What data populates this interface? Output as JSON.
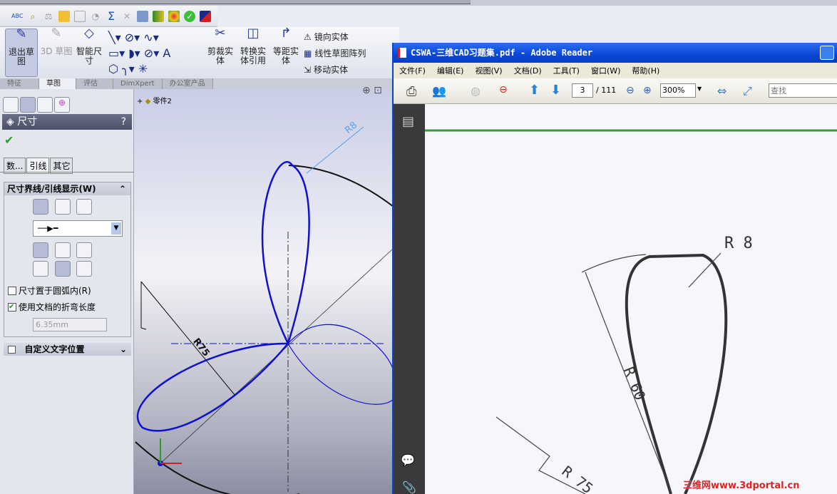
{
  "sw": {
    "command_manager": {
      "exit_sketch": "退出草图",
      "sketch_3d": "3D 草图",
      "smart_dim": "智能尺寸",
      "trim": "剪裁实体",
      "convert": "转换实体引用",
      "offset": "等距实体",
      "mirror": "镜向实体",
      "linear_pattern": "线性草图阵列",
      "move": "移动实体"
    },
    "tabs": [
      "特征",
      "草图",
      "评估",
      "DimXpert",
      "办公室产品"
    ],
    "active_tab": 1,
    "tree_item": "零件2",
    "panel": {
      "title": "尺寸",
      "help": "?",
      "subtabs": [
        "数...",
        "引线",
        "其它"
      ],
      "active_subtab": 1,
      "group1_title": "尺寸界线/引线显示(W)",
      "checkbox1": {
        "label": "尺寸置于圆弧内(R)",
        "checked": false
      },
      "checkbox2": {
        "label": "使用文档的折弯长度",
        "checked": true
      },
      "bend_length": "6.35mm",
      "group2_title": "自定义文字位置"
    },
    "dims": {
      "r8": "R8",
      "r75": "R75"
    }
  },
  "adobe": {
    "title": "CSWA-三维CAD习题集.pdf - Adobe Reader",
    "menu": [
      "文件(F)",
      "编辑(E)",
      "视图(V)",
      "文档(D)",
      "工具(T)",
      "窗口(W)",
      "帮助(H)"
    ],
    "page": "3",
    "page_total": "/ 111",
    "zoom": "300%",
    "search_placeholder": "查找",
    "drawing_labels": {
      "r8": "R 8",
      "r60": "R 60",
      "r75": "R 75"
    }
  },
  "watermark": "三维网www.3dportal.cn",
  "colors": {
    "sketch": "#1010d0",
    "title_bar": "#0a46d6"
  }
}
